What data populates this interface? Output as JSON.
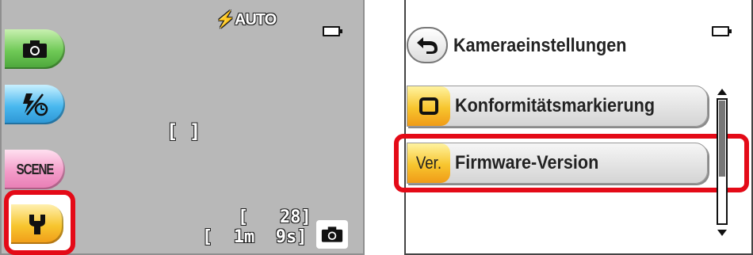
{
  "shooting_screen": {
    "flash_mode": "⚡AUTO",
    "focus_bracket": "[   ]",
    "exposures_remaining": "[   28]",
    "movie_time_remaining": "[  1m  9s]",
    "scene_label": "SCENE",
    "mode_buttons": [
      {
        "icon": "camera-icon",
        "color": "#6fc956"
      },
      {
        "icon": "flash-selftimer-icon",
        "color": "#49b8ef"
      },
      {
        "icon": "scene-icon",
        "color": "#f39cc9"
      },
      {
        "icon": "wrench-icon",
        "color": "#f7c52e"
      }
    ]
  },
  "settings_menu": {
    "title": "Kameraeinstellungen",
    "items": [
      {
        "label": "Konformitätsmarkierung",
        "icon": "square-icon"
      },
      {
        "label": "Firmware-Version",
        "icon_text": "Ver.",
        "selected": true
      }
    ]
  },
  "colors": {
    "highlight": "#e40a17",
    "setup_tab": "#f7c52e"
  }
}
